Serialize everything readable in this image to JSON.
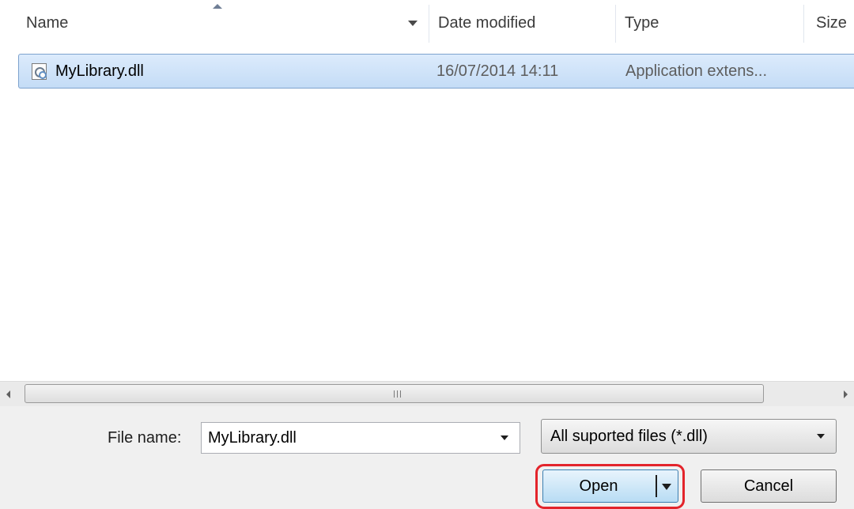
{
  "columns": {
    "name": "Name",
    "date_modified": "Date modified",
    "type": "Type",
    "size": "Size"
  },
  "files": [
    {
      "name": "MyLibrary.dll",
      "date_modified": "16/07/2014 14:11",
      "type": "Application extens...",
      "icon": "dll-file-icon",
      "selected": true
    }
  ],
  "scrollbar": {
    "grip_icon": "scroll-grip-icon"
  },
  "bottom": {
    "file_name_label": "File name:",
    "file_name_value": "MyLibrary.dll",
    "filter_value": "All suported files (*.dll)",
    "open_label": "Open",
    "cancel_label": "Cancel"
  },
  "colors": {
    "selection": "#cce4fb",
    "highlight_outline": "#e3242b",
    "open_button": "#b8dcf4"
  }
}
